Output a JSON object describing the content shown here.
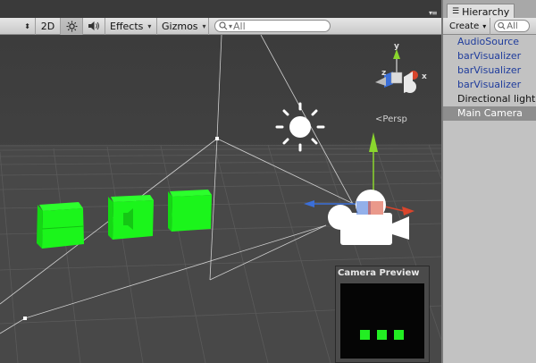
{
  "scene_toolbar": {
    "shading_arrows": "⬍",
    "mode_2d_label": "2D",
    "light_icon": "sun-icon",
    "audio_icon": "speaker-icon",
    "effects_label": "Effects",
    "gizmos_label": "Gizmos",
    "search_placeholder": "All"
  },
  "scene": {
    "projection_label": "Persp",
    "gizmo_axes": [
      "y",
      "z",
      "x"
    ],
    "colors": {
      "background": "#474747",
      "cube": "#1bf51b",
      "x_axis": "#d9452c",
      "y_axis": "#8ad62d",
      "z_axis": "#3b6fd8"
    }
  },
  "camera_preview": {
    "title": "Camera Preview"
  },
  "hierarchy": {
    "tab_label": "Hierarchy",
    "create_label": "Create",
    "search_placeholder": "All",
    "items": [
      {
        "label": "AudioSource",
        "kind": "prefab"
      },
      {
        "label": "barVisualizer",
        "kind": "prefab"
      },
      {
        "label": "barVisualizer",
        "kind": "prefab"
      },
      {
        "label": "barVisualizer",
        "kind": "prefab"
      },
      {
        "label": "Directional light",
        "kind": "normal"
      },
      {
        "label": "Main Camera",
        "kind": "selected"
      }
    ]
  }
}
